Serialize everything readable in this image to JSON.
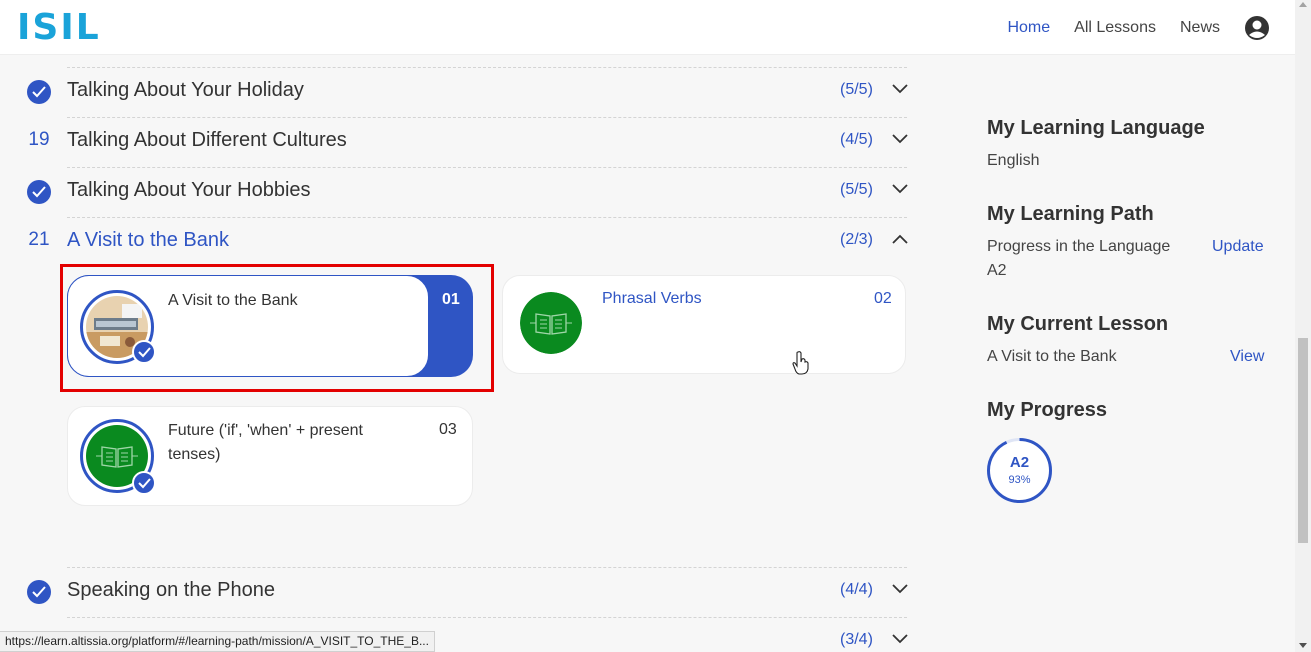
{
  "header": {
    "logo": "ISIL",
    "nav": [
      "Home",
      "All Lessons",
      "News"
    ]
  },
  "lessons": [
    {
      "num": "",
      "title": "Talking About Your Holiday",
      "count": "(5/5)",
      "done": true
    },
    {
      "num": "19",
      "title": "Talking About Different Cultures",
      "count": "(4/5)",
      "done": false
    },
    {
      "num": "",
      "title": "Talking About Your Hobbies",
      "count": "(5/5)",
      "done": true
    },
    {
      "num": "21",
      "title": "A Visit to the Bank",
      "count": "(2/3)",
      "done": false,
      "open": true
    },
    {
      "num": "",
      "title": "Speaking on the Phone",
      "count": "(4/4)",
      "done": true
    },
    {
      "num": "",
      "title": "",
      "count": "(3/4)",
      "done": false
    }
  ],
  "activities": [
    {
      "title": "A Visit to the Bank",
      "num": "01"
    },
    {
      "title": "Phrasal Verbs",
      "num": "02"
    },
    {
      "title": "Future ('if', 'when' + present tenses)",
      "num": "03"
    }
  ],
  "side": {
    "language_heading": "My Learning Language",
    "language_value": "English",
    "path_heading": "My Learning Path",
    "path_label": "Progress in the Language",
    "path_update": "Update",
    "path_level": "A2",
    "current_heading": "My Current Lesson",
    "current_value": "A Visit to the Bank",
    "current_view": "View",
    "progress_heading": "My Progress",
    "progress_level": "A2",
    "progress_pct": "93%",
    "progress_value": 0.93
  },
  "status_url": "https://learn.altissia.org/platform/#/learning-path/mission/A_VISIT_TO_THE_B...",
  "colors": {
    "accent": "#2f55c4",
    "logo": "#1aa3d9",
    "green": "#0a8a1f",
    "highlight": "#e30000"
  }
}
